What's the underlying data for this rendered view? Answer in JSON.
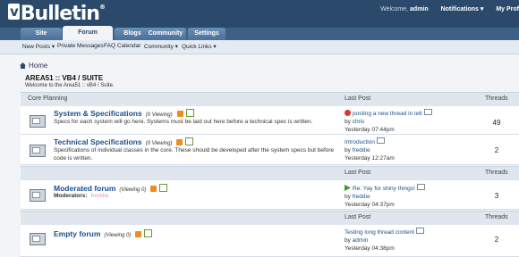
{
  "brand": {
    "logo_text": "Bulletin",
    "logo_badge": "v",
    "logo_mark": "®"
  },
  "userbar": {
    "welcome": "Welcome,",
    "username": "admin",
    "notifications": "Notifications ▾",
    "profile": "My Prof"
  },
  "tabs": [
    "Site",
    "Forum",
    "Blogs",
    "Community",
    "Settings"
  ],
  "subnav": [
    "New Posts ▾",
    "Private Messages",
    "FAQ",
    "Calendar",
    "Community ▾",
    "Quick Links ▾"
  ],
  "breadcrumb": {
    "home": "Home"
  },
  "page": {
    "title": "AREA51 :: VB4 / SUITE",
    "subtitle": "Welcome to the Area51 :: vB4 / Suite."
  },
  "headers": {
    "last_post": "Last Post",
    "threads": "Threads"
  },
  "sections": [
    {
      "title": "Core Planning",
      "forums": [
        {
          "name": "System & Specifications",
          "viewing": "(0 Viewing)",
          "desc": "Specs for each system will go here. Systems must be laid out here before a technical spec is written.",
          "lp_title": "posting a new thread in ie6",
          "lp_by": "by",
          "lp_user": "chris",
          "lp_time": "Yesterday 07:44pm",
          "threads": "49"
        },
        {
          "name": "Technical Specifications",
          "viewing": "(0 Viewing)",
          "desc": "Specifications of individual classes in the core. These should be developed after the system specs but before code is written.",
          "lp_title": "Introduction",
          "lp_by": "by",
          "lp_user": "freddie",
          "lp_time": "Yesterday 12:27am",
          "threads": "2"
        }
      ]
    },
    {
      "forums": [
        {
          "name": "Moderated forum",
          "viewing": "(Viewing 0)",
          "mod_label": "Moderators:",
          "mod_name": "freddie",
          "lp_title": "Re: Yay for shiny things!",
          "lp_by": "by",
          "lp_user": "freddie",
          "lp_time": "Yesterday 04:37pm",
          "threads": "3"
        }
      ]
    },
    {
      "forums": [
        {
          "name": "Empty forum",
          "viewing": "(Viewing 0)",
          "lp_title": "Testing long thread content",
          "lp_by": "by",
          "lp_user": "admin",
          "lp_time": "Yesterday 04:38pm",
          "threads": "2"
        }
      ]
    }
  ],
  "colors": {
    "header_bg": "#2b4a6b",
    "tab_bg": "#3c6184",
    "link": "#1d4f8c",
    "rss": "#f08c1c"
  }
}
